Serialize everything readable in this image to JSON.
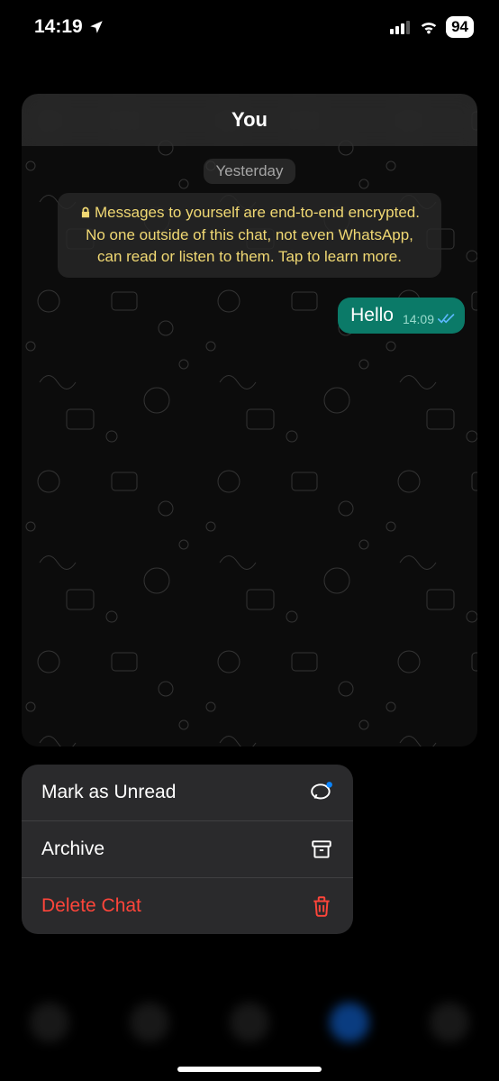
{
  "status": {
    "time": "14:19",
    "battery": "94"
  },
  "chat": {
    "title": "You",
    "date_label": "Yesterday",
    "encryption_notice": "Messages to yourself are end-to-end encrypted. No one outside of this chat, not even WhatsApp, can read or listen to them. Tap to learn more.",
    "message": {
      "text": "Hello",
      "time": "14:09"
    }
  },
  "menu": {
    "mark_unread": "Mark as Unread",
    "archive": "Archive",
    "delete": "Delete Chat"
  }
}
